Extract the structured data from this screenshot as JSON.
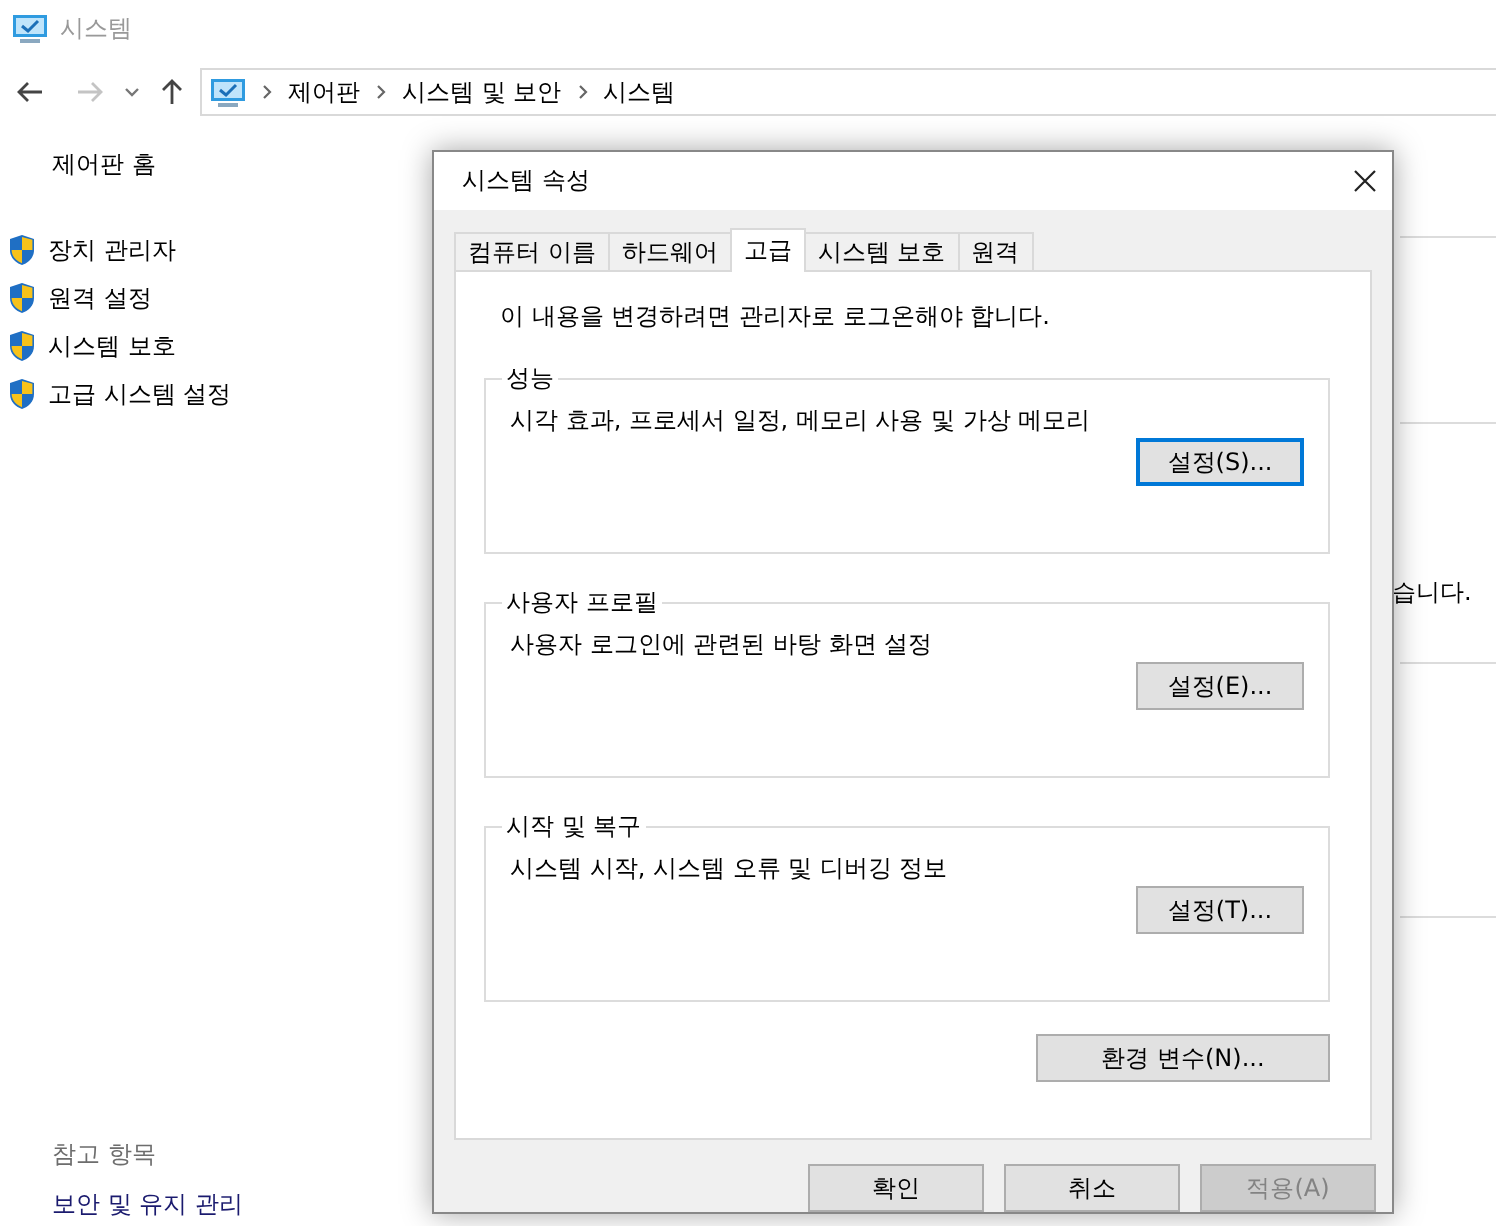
{
  "window": {
    "title": "시스템"
  },
  "breadcrumb": [
    "제어판",
    "시스템 및 보안",
    "시스템"
  ],
  "sidebar": {
    "home": "제어판 홈",
    "items": [
      "장치 관리자",
      "원격 설정",
      "시스템 보호",
      "고급 시스템 설정"
    ],
    "see_also": {
      "heading": "참고 항목",
      "links": [
        "보안 및 유지 관리"
      ]
    }
  },
  "content_fragment": "습니다.",
  "dialog": {
    "title": "시스템 속성",
    "tabs": [
      {
        "label": "컴퓨터 이름",
        "selected": false
      },
      {
        "label": "하드웨어",
        "selected": false
      },
      {
        "label": "고급",
        "selected": true
      },
      {
        "label": "시스템 보호",
        "selected": false
      },
      {
        "label": "원격",
        "selected": false
      }
    ],
    "notice": "이 내용을 변경하려면 관리자로 로그온해야 합니다.",
    "groups": [
      {
        "title": "성능",
        "description": "시각 효과, 프로세서 일정, 메모리 사용 및 가상 메모리",
        "button": "설정(S)...",
        "focused": true
      },
      {
        "title": "사용자 프로필",
        "description": "사용자 로그인에 관련된 바탕 화면 설정",
        "button": "설정(E)...",
        "focused": false
      },
      {
        "title": "시작 및 복구",
        "description": "시스템 시작, 시스템 오류 및 디버깅 정보",
        "button": "설정(T)...",
        "focused": false
      }
    ],
    "env_button": "환경 변수(N)...",
    "footer_buttons": [
      {
        "label": "확인",
        "disabled": false
      },
      {
        "label": "취소",
        "disabled": false
      },
      {
        "label": "적용(A)",
        "disabled": true
      }
    ]
  }
}
